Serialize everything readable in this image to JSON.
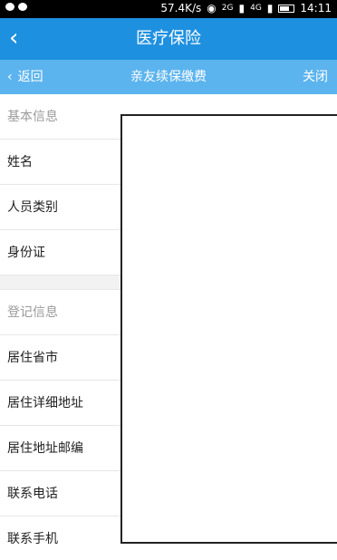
{
  "status_bar": {
    "speed": "57.4K/s",
    "net_badge": "2G",
    "net_badge2": "4G",
    "time": "14:11"
  },
  "header": {
    "title": "医疗保险"
  },
  "subheader": {
    "back_label": "返回",
    "title": "亲友续保缴费",
    "close_label": "关闭"
  },
  "sections": [
    {
      "title": "基本信息",
      "items": [
        "姓名",
        "人员类别",
        "身份证"
      ]
    },
    {
      "title": "登记信息",
      "items": [
        "居住省市",
        "居住详细地址",
        "居住地址邮编",
        "联系电话",
        "联系手机"
      ]
    }
  ]
}
